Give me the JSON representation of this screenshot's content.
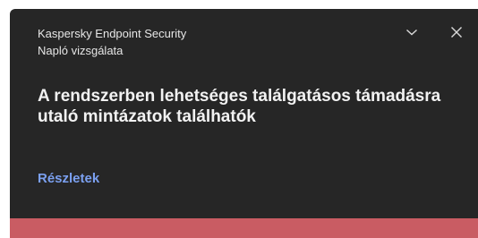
{
  "notification": {
    "app_name": "Kaspersky Endpoint Security",
    "sub_title": "Napló vizsgálata",
    "message": "A rendszerben lehetséges találgatásos támadásra utaló mintázatok találhatók",
    "details_link": "Részletek",
    "icons": [
      "chevron-down-icon",
      "close-icon"
    ],
    "colors": {
      "background": "#262626",
      "link": "#7ba0f0",
      "severity": "#c95c63"
    }
  }
}
